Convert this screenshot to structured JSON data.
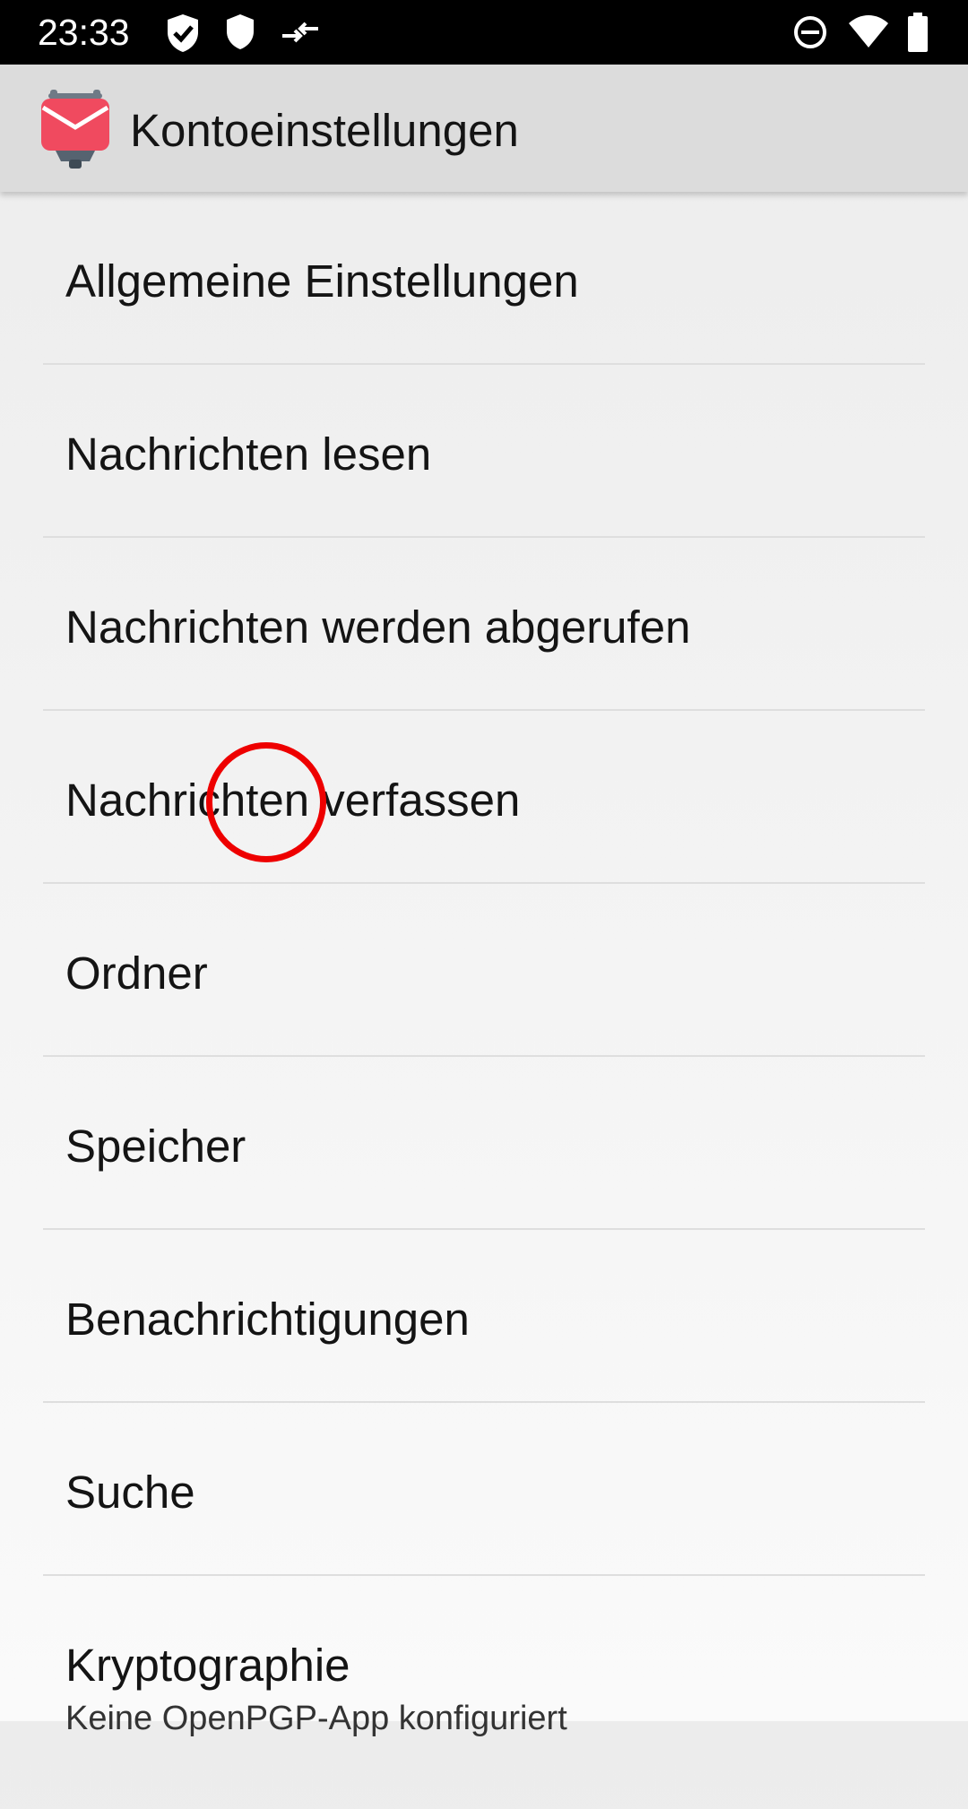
{
  "status_bar": {
    "time": "23:33",
    "icons_left": [
      "shield-check-icon",
      "shield-icon",
      "data-transfer-icon"
    ],
    "icons_right": [
      "do-not-disturb-icon",
      "wifi-icon",
      "battery-icon"
    ]
  },
  "app_bar": {
    "title": "Kontoeinstellungen",
    "logo_icon": "k9-mail-logo-icon",
    "logo_color": "#f04a5f"
  },
  "settings_items": [
    {
      "label": "Allgemeine Einstellungen"
    },
    {
      "label": "Nachrichten lesen"
    },
    {
      "label": "Nachrichten werden abgerufen"
    },
    {
      "label": "Nachrichten verfassen"
    },
    {
      "label": "Ordner"
    },
    {
      "label": "Speicher"
    },
    {
      "label": "Benachrichtigungen"
    },
    {
      "label": "Suche"
    },
    {
      "label": "Kryptographie",
      "summary": "Keine OpenPGP-App konfiguriert"
    }
  ],
  "tap_marker_color": "#ee0000"
}
